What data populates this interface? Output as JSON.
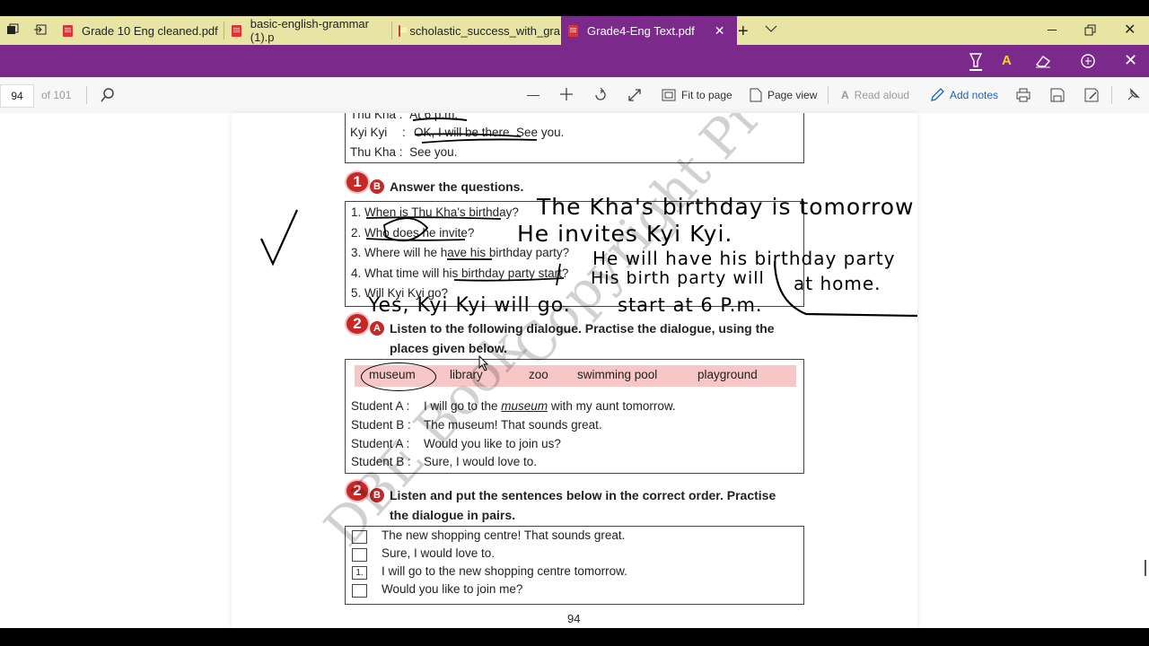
{
  "tabs": [
    {
      "label": "Grade 10 Eng cleaned.pdf",
      "active": false
    },
    {
      "label": "basic-english-grammar (1).p",
      "active": false
    },
    {
      "label": "scholastic_success_with_gra",
      "active": false
    },
    {
      "label": "Grade4-Eng Text.pdf",
      "active": true
    }
  ],
  "toolbar": {
    "page_input": "94",
    "page_total": "of 101",
    "fit_label": "Fit to page",
    "page_view_label": "Page view",
    "read_aloud_label": "Read aloud",
    "add_notes_label": "Add notes"
  },
  "doc": {
    "dialogue_top": [
      {
        "speaker": "Thu Kha :",
        "text": "At 6 p.m."
      },
      {
        "speaker": "Kyi Kyi",
        "colon": ":",
        "text": "OK, I will be there. See you."
      },
      {
        "speaker": "Thu Kha :",
        "text": "See you."
      }
    ],
    "ex1b": {
      "badge": "1",
      "sub": "B",
      "heading": "Answer the questions.",
      "questions": [
        "1.  When is Thu Kha's birthday?",
        "2.  Who does he invite?",
        "3.  Where will he have his birthday party?",
        "4.  What time will his birthday party start?",
        "5.  Will Kyi Kyi go?"
      ]
    },
    "ex2a": {
      "badge": "2",
      "sub": "A",
      "heading_line1": "Listen to the following dialogue. Practise the dialogue, using the",
      "heading_line2": "places given below.",
      "word_bank": [
        "museum",
        "library",
        "zoo",
        "swimming pool",
        "playground"
      ],
      "dialogue": [
        {
          "speaker": "Student A :",
          "pre": "I will go to the ",
          "em": "museum",
          "post": " with my aunt tomorrow."
        },
        {
          "speaker": "Student B :",
          "pre": "The museum! That sounds great.",
          "em": "",
          "post": ""
        },
        {
          "speaker": "Student A :",
          "pre": "Would you like to join us?",
          "em": "",
          "post": ""
        },
        {
          "speaker": "Student B :",
          "pre": "Sure, I would love to.",
          "em": "",
          "post": ""
        }
      ]
    },
    "ex2b": {
      "badge": "2",
      "sub": "B",
      "heading_line1": "Listen and put the sentences below in the correct order. Practise",
      "heading_line2": "the dialogue in pairs.",
      "items": [
        {
          "check": "",
          "text": "The new shopping centre! That sounds great."
        },
        {
          "check": "",
          "text": "Sure, I would love to."
        },
        {
          "check": "1.",
          "text": "I will go to the new shopping centre tomorrow."
        },
        {
          "check": "",
          "text": "Would you like to join me?"
        }
      ]
    },
    "page_number": "94",
    "watermark_1": "DBE Book",
    "watermark_2": "Copyright Pro"
  },
  "handwriting": [
    "The Kha's birthday is tomorrow",
    "He invites Kyi Kyi.",
    "He will have his birthday party",
    "at home.",
    "His birth party will",
    "start at 6 P.m.",
    "Yes, Kyi Kyi will go."
  ]
}
